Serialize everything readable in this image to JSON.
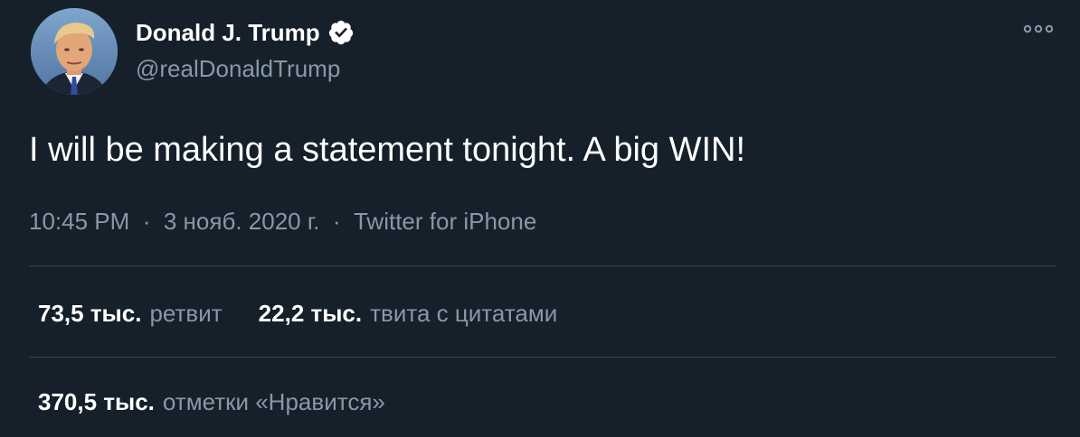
{
  "user": {
    "display_name": "Donald J. Trump",
    "handle": "@realDonaldTrump",
    "verified": true
  },
  "tweet": {
    "text": "I will be making a statement tonight. A big WIN!",
    "time": "10:45 PM",
    "date": "3 нояб. 2020 г.",
    "separator": "·",
    "source": "Twitter for iPhone"
  },
  "stats": {
    "retweets": {
      "count": "73,5 тыс.",
      "label": "ретвит"
    },
    "quotes": {
      "count": "22,2 тыс.",
      "label": "твита с цитатами"
    },
    "likes": {
      "count": "370,5 тыс.",
      "label": "отметки «Нравится»"
    }
  },
  "colors": {
    "background": "#15202b",
    "primary_text": "#ffffff",
    "secondary_text": "#8899a6",
    "divider": "#38444d",
    "verified_badge": "#ffffff"
  },
  "icons": {
    "verified": "verified-badge-icon",
    "more": "more-options-icon"
  }
}
